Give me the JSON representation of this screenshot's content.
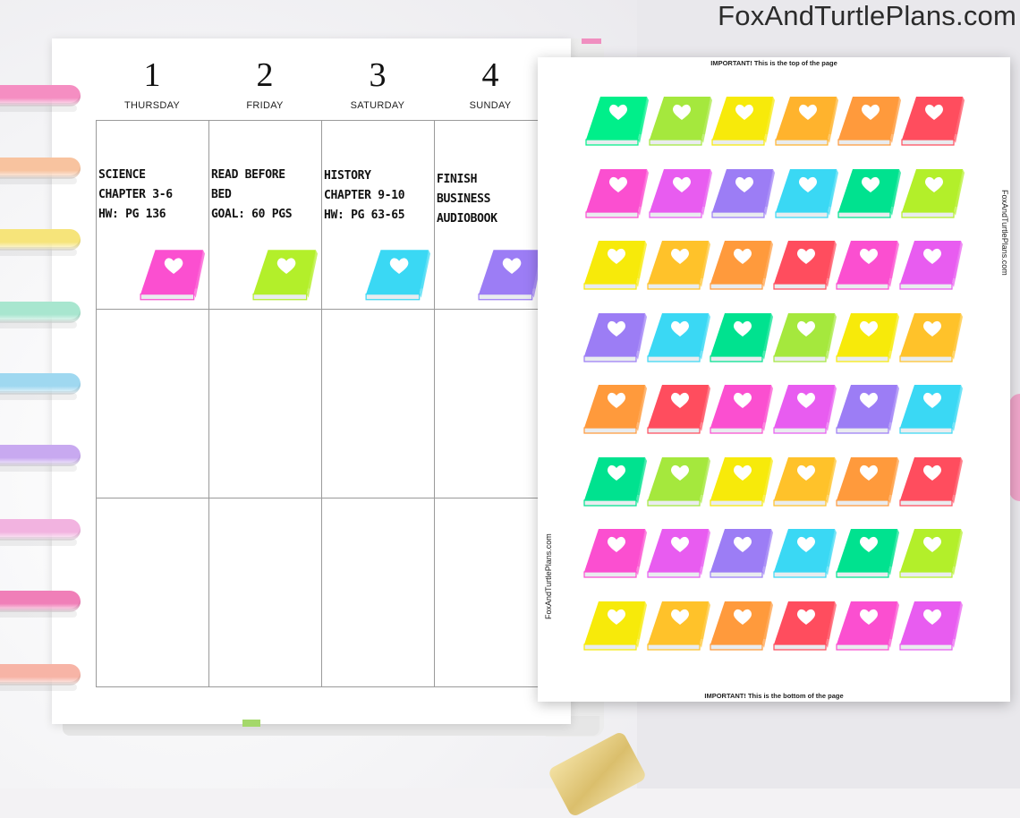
{
  "brand": {
    "text": "FoxAndTurtlePlans.com"
  },
  "rings": [
    "#f58ec2",
    "#f8c39f",
    "#f6e47a",
    "#a8e6cf",
    "#9fd8f0",
    "#c8a9f0",
    "#f2b3e0",
    "#f07fb8",
    "#f7b4a6"
  ],
  "days": [
    {
      "number": "1",
      "name": "THURSDAY"
    },
    {
      "number": "2",
      "name": "FRIDAY"
    },
    {
      "number": "3",
      "name": "SATURDAY"
    },
    {
      "number": "4",
      "name": "SUNDAY"
    }
  ],
  "tasks": [
    {
      "lines": [
        "SCIENCE",
        "CHAPTER 3-6",
        "HW: PG 136"
      ],
      "sticker_color": "#fb4fd0"
    },
    {
      "lines": [
        "READ BEFORE",
        "BED",
        "GOAL: 60 PGS"
      ],
      "sticker_color": "#b3ef2a"
    },
    {
      "lines": [
        "HISTORY",
        "CHAPTER 9-10",
        "HW: PG 63-65"
      ],
      "sticker_color": "#3ad8f4"
    },
    {
      "lines": [
        "FINISH",
        "BUSINESS",
        "AUDIOBOOK"
      ],
      "sticker_color": "#9c7df5"
    }
  ],
  "sheet": {
    "top_note": "IMPORTANT! This is the top of the page",
    "bottom_note": "IMPORTANT! This is the bottom of the page",
    "side_text": "FoxAndTurtlePlans.com",
    "sticker_rows": [
      [
        "#00ef8a",
        "#a5e83d",
        "#f7ea0a",
        "#ffb32d",
        "#ff9a3c",
        "#ff4d5e"
      ],
      [
        "#fb4fd0",
        "#e85cf0",
        "#9c7df5",
        "#3ad8f4",
        "#00e28f",
        "#b3ef2a"
      ],
      [
        "#f7ea0a",
        "#ffc22a",
        "#ff9a3c",
        "#ff4d5e",
        "#fb4fd0",
        "#e85cf0"
      ],
      [
        "#9c7df5",
        "#3ad8f4",
        "#00e28f",
        "#a5e83d",
        "#f7ea0a",
        "#ffc22a"
      ],
      [
        "#ff9a3c",
        "#ff4d5e",
        "#fb4fd0",
        "#e85cf0",
        "#9c7df5",
        "#3ad8f4"
      ],
      [
        "#00e28f",
        "#a5e83d",
        "#f7ea0a",
        "#ffc22a",
        "#ff9a3c",
        "#ff4d5e"
      ],
      [
        "#fb4fd0",
        "#e85cf0",
        "#9c7df5",
        "#3ad8f4",
        "#00e28f",
        "#b3ef2a"
      ],
      [
        "#f7ea0a",
        "#ffc22a",
        "#ff9a3c",
        "#ff4d5e",
        "#fb4fd0",
        "#e85cf0"
      ]
    ]
  }
}
